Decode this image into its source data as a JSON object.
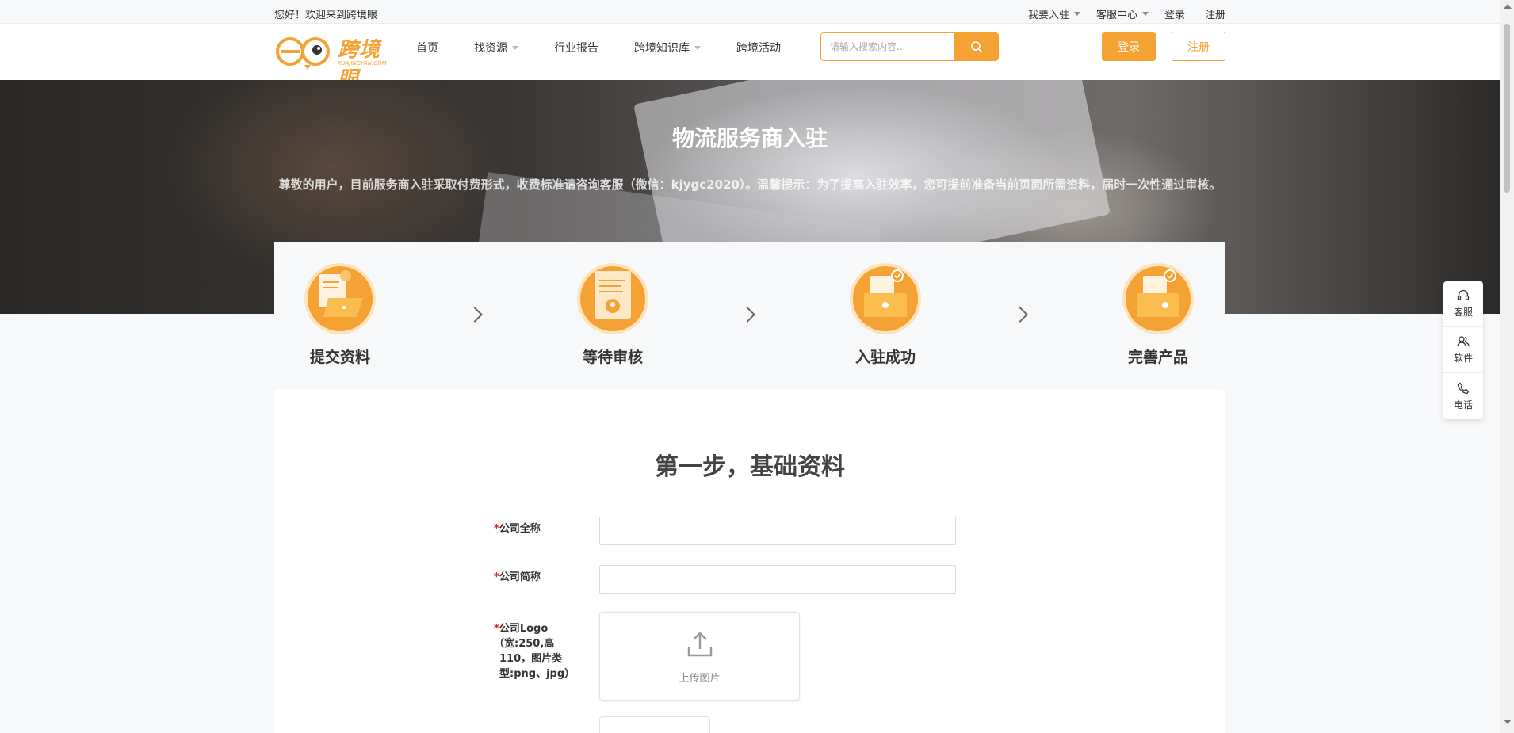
{
  "topbar": {
    "welcome": "您好！欢迎来到跨境眼",
    "settle_in": "我要入驻",
    "service_center": "客服中心",
    "login": "登录",
    "register": "注册"
  },
  "header": {
    "logo_text": "跨境眼",
    "logo_sub": "KUAJINGYAN.COM",
    "nav": [
      {
        "label": "首页",
        "dropdown": false
      },
      {
        "label": "找资源",
        "dropdown": true
      },
      {
        "label": "行业报告",
        "dropdown": false
      },
      {
        "label": "跨境知识库",
        "dropdown": true
      },
      {
        "label": "跨境活动",
        "dropdown": false
      }
    ],
    "search_placeholder": "请输入搜索内容...",
    "login_button": "登录",
    "register_button": "注册"
  },
  "banner": {
    "title": "物流服务商入驻",
    "description": "尊敬的用户，目前服务商入驻采取付费形式，收费标准请咨询客服（微信：kjygc2020）。温馨提示：为了提高入驻效率，您可提前准备当前页面所需资料，届时一次性通过审核。"
  },
  "steps": [
    {
      "label": "提交资料",
      "icon": "submit-documents-icon"
    },
    {
      "label": "等待审核",
      "icon": "review-pending-icon"
    },
    {
      "label": "入驻成功",
      "icon": "settle-success-icon"
    },
    {
      "label": "完善产品",
      "icon": "complete-product-icon"
    }
  ],
  "form": {
    "heading": "第一步，基础资料",
    "fields": [
      {
        "required_mark": "*",
        "label": "公司全称",
        "value": ""
      },
      {
        "required_mark": "*",
        "label": "公司简称",
        "value": ""
      }
    ],
    "logo_field": {
      "required_mark": "*",
      "label": "公司Logo",
      "hint_line1": "（宽:250,高",
      "hint_line2": "110，图片类",
      "hint_line3": "型:png、jpg）",
      "upload_label": "上传图片"
    }
  },
  "float_toolbar": [
    {
      "label": "客服",
      "icon": "headset-icon"
    },
    {
      "label": "软件",
      "icon": "users-icon"
    },
    {
      "label": "电话",
      "icon": "phone-icon"
    }
  ],
  "colors": {
    "accent": "#f5a234",
    "required": "#e02020"
  }
}
